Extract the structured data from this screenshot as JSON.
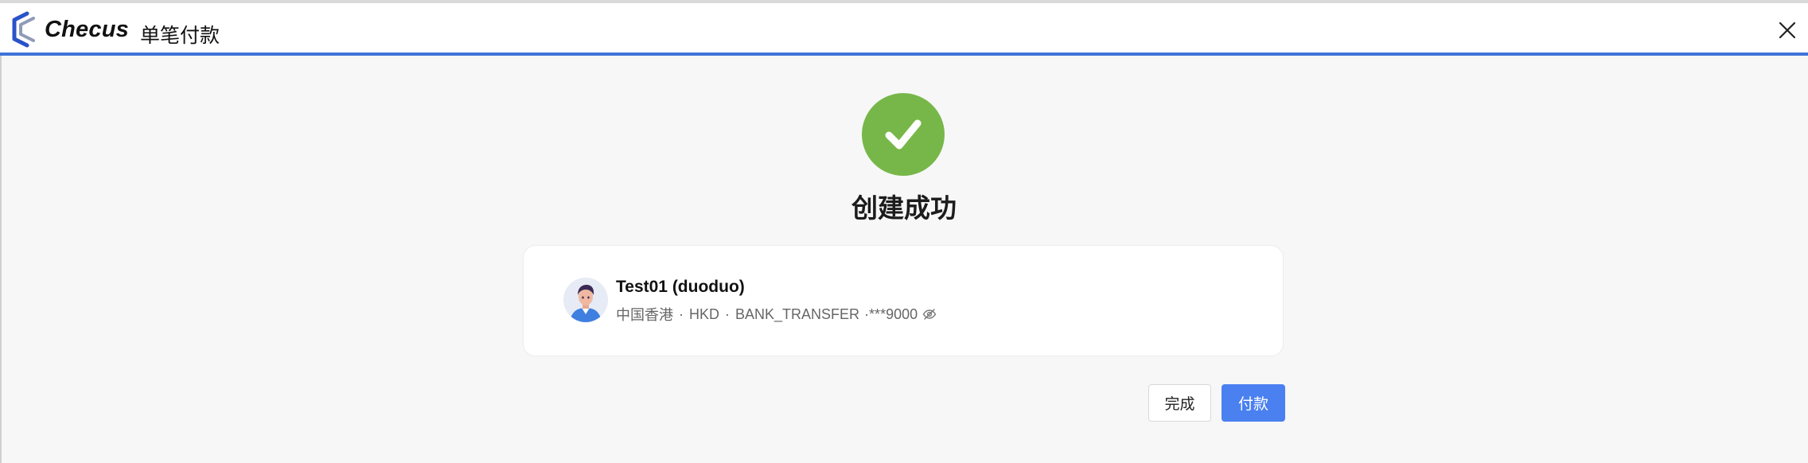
{
  "header": {
    "brand": "Checus",
    "title": "单笔付款"
  },
  "main": {
    "success_title": "创建成功",
    "payee": {
      "name": "Test01 (duoduo)",
      "region": "中国香港",
      "currency": "HKD",
      "method": "BANK_TRANSFER",
      "account": "·***9000",
      "separator": "·"
    },
    "buttons": {
      "done": "完成",
      "pay": "付款"
    }
  },
  "colors": {
    "accent": "#4a80f0",
    "header_border": "#3f73d8",
    "success": "#77b74a"
  },
  "icons": {
    "logo": "checus-logo-icon",
    "close": "close-icon",
    "success": "check-circle-icon",
    "avatar": "avatar-icon",
    "eye": "eye-off-icon"
  }
}
